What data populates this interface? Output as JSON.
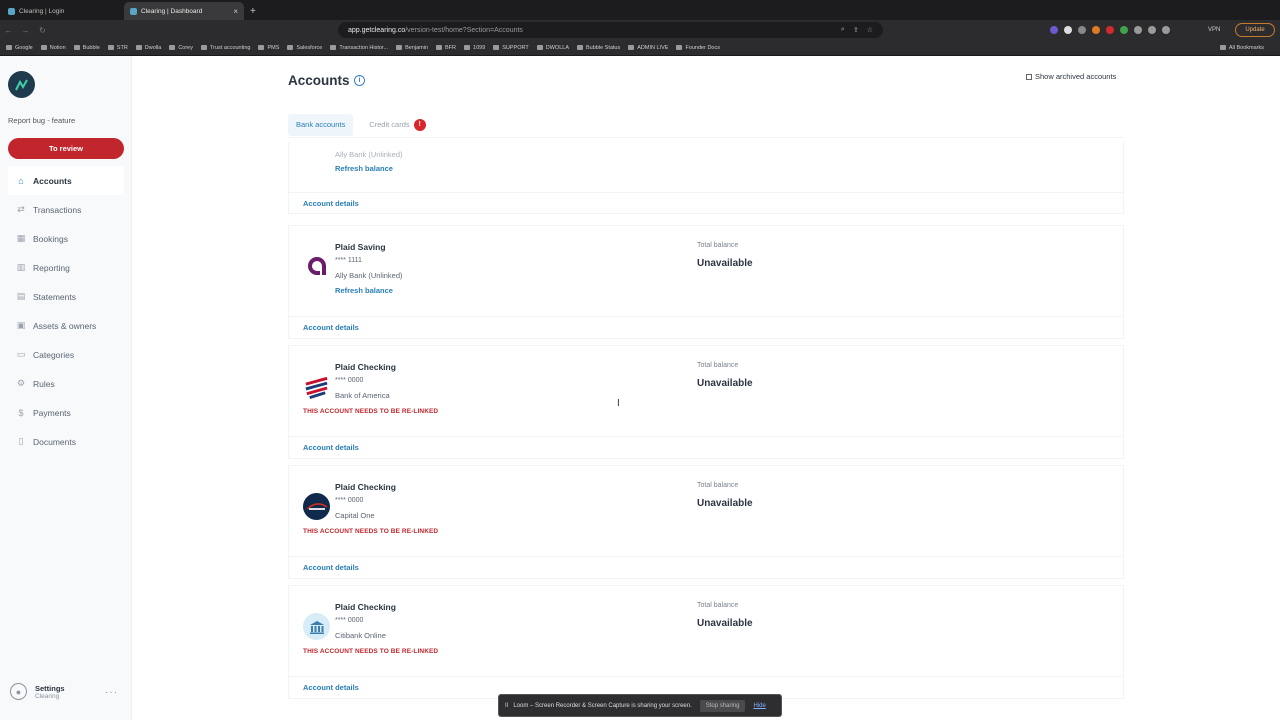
{
  "browser": {
    "tabs": [
      {
        "label": "Clearing | Login",
        "active": false
      },
      {
        "label": "Clearing | Dashboard",
        "active": true
      }
    ],
    "new_tab": "+",
    "close": "×",
    "url_host": "app.getclearing.co",
    "url_path": "/version-test/home?Section=Accounts",
    "vpn": "VPN",
    "update": "Update",
    "bookmarks": [
      "Google",
      "Notion",
      "Bubble",
      "STR",
      "Dwolla",
      "Corey",
      "Trust accounting",
      "PMS",
      "Salesforce",
      "Transaction Histor...",
      "Benjamin",
      "BFR",
      "1099",
      "SUPPORT",
      "DWOLLA",
      "Bubble Status",
      "ADMIN LIVE",
      "Founder Docs"
    ],
    "all_bookmarks": "All Bookmarks"
  },
  "sidebar": {
    "report_bug": "Report bug - feature",
    "to_review": "To review",
    "items": [
      {
        "label": "Accounts",
        "icon": "bank-icon",
        "glyph": "⌂",
        "active": true
      },
      {
        "label": "Transactions",
        "icon": "arrows-icon",
        "glyph": "⇄",
        "active": false
      },
      {
        "label": "Bookings",
        "icon": "calendar-icon",
        "glyph": "▦",
        "active": false
      },
      {
        "label": "Reporting",
        "icon": "chart-icon",
        "glyph": "▥",
        "active": false
      },
      {
        "label": "Statements",
        "icon": "document-icon",
        "glyph": "▤",
        "active": false
      },
      {
        "label": "Assets & owners",
        "icon": "building-icon",
        "glyph": "▣",
        "active": false
      },
      {
        "label": "Categories",
        "icon": "folder-icon",
        "glyph": "▭",
        "active": false
      },
      {
        "label": "Rules",
        "icon": "rules-icon",
        "glyph": "⚙",
        "active": false
      },
      {
        "label": "Payments",
        "icon": "dollar-icon",
        "glyph": "$",
        "active": false
      },
      {
        "label": "Documents",
        "icon": "file-icon",
        "glyph": "▯",
        "active": false
      }
    ],
    "settings_title": "Settings",
    "settings_sub": "Clearing"
  },
  "page": {
    "title": "Accounts",
    "show_archived": "Show archived accounts",
    "tabs": {
      "bank": "Bank accounts",
      "credit": "Credit cards",
      "credit_badge": "!"
    }
  },
  "partial": {
    "bank": "Ally Bank (Unlinked)",
    "refresh": "Refresh balance",
    "details": "Account details"
  },
  "accounts": [
    {
      "name": "Plaid Saving",
      "mask": "**** 1111",
      "bank": "Ally Bank (Unlinked)",
      "refresh": "Refresh balance",
      "balance_label": "Total balance",
      "balance": "Unavailable",
      "details": "Account details",
      "logo_color": "#6b1d6b"
    },
    {
      "name": "Plaid Checking",
      "mask": "**** 0000",
      "bank": "Bank of America",
      "relink": "THIS ACCOUNT NEEDS TO BE RE-LINKED",
      "balance_label": "Total balance",
      "balance": "Unavailable",
      "details": "Account details",
      "logo_color": "#c8102e"
    },
    {
      "name": "Plaid Checking",
      "mask": "**** 0000",
      "bank": "Capital One",
      "relink": "THIS ACCOUNT NEEDS TO BE RE-LINKED",
      "balance_label": "Total balance",
      "balance": "Unavailable",
      "details": "Account details",
      "logo_color": "#0f2a4a"
    },
    {
      "name": "Plaid Checking",
      "mask": "**** 0000",
      "bank": "Citibank Online",
      "relink": "THIS ACCOUNT NEEDS TO BE RE-LINKED",
      "balance_label": "Total balance",
      "balance": "Unavailable",
      "details": "Account details",
      "logo_color": "#d6ecf7"
    }
  ],
  "loom": {
    "message": "Loom – Screen Recorder & Screen Capture is sharing your screen.",
    "stop": "Stop sharing",
    "hide": "Hide"
  }
}
